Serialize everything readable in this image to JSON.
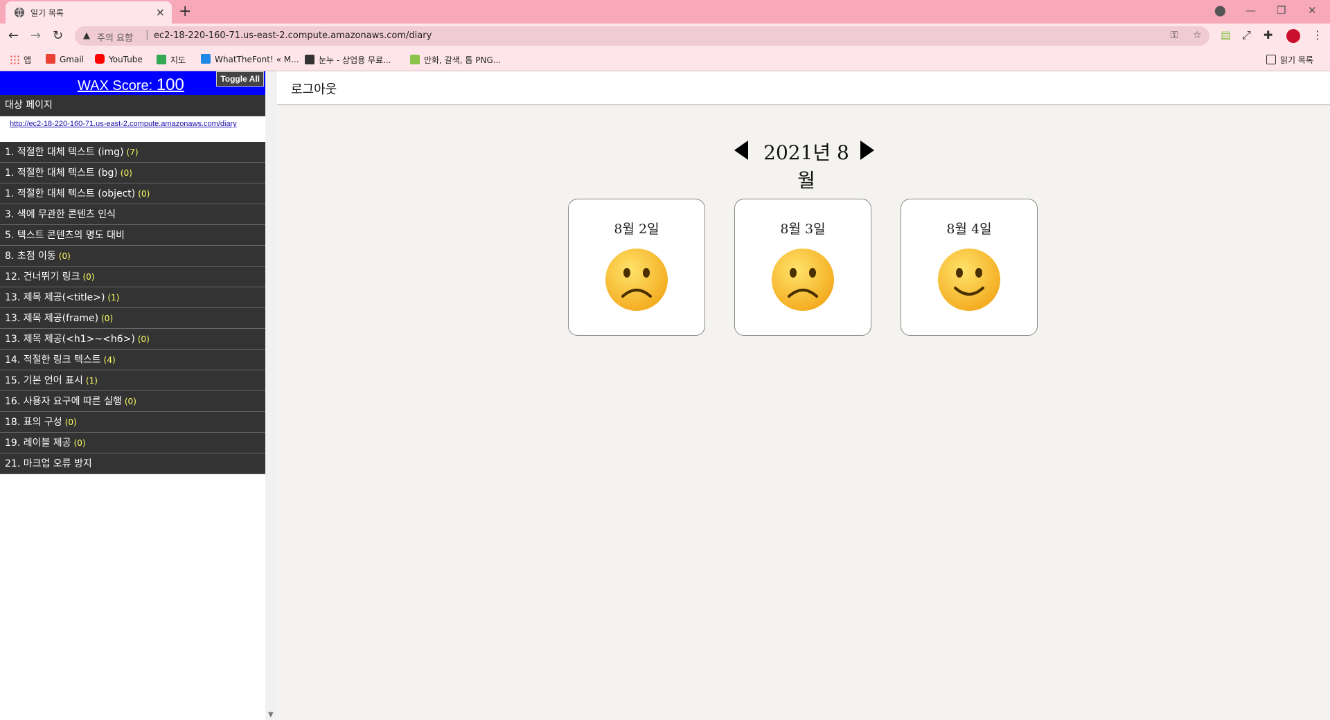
{
  "browser": {
    "tab_title": "일기 목록",
    "tab_close": "×",
    "new_tab": "+",
    "security_warning": "주의 요함",
    "url": "ec2-18-220-160-71.us-east-2.compute.amazonaws.com/diary",
    "reading_list": "읽기 목록"
  },
  "bookmarks": [
    {
      "label": "앱",
      "icon": "apps-grid-icon",
      "color": "#e74c3c"
    },
    {
      "label": "Gmail",
      "icon": "gmail-icon",
      "color": "#ea4335"
    },
    {
      "label": "YouTube",
      "icon": "youtube-icon",
      "color": "#ff0000"
    },
    {
      "label": "지도",
      "icon": "maps-icon",
      "color": "#34a853"
    },
    {
      "label": "WhatTheFont! « M...",
      "icon": "whatthefont-icon",
      "color": "#1e88e5"
    },
    {
      "label": "눈누 - 상업용 무료...",
      "icon": "noonnu-icon",
      "color": "#333333"
    },
    {
      "label": "만화, 갈색, 톱 PNG...",
      "icon": "png-site-icon",
      "color": "#8bc34a"
    }
  ],
  "wax": {
    "label": "WAX Score:",
    "score": "100",
    "toggle_all": "Toggle All",
    "target_heading": "대상 페이지",
    "target_url": "http://ec2-18-220-160-71.us-east-2.compute.amazonaws.com/diary",
    "items": [
      {
        "label": "1. 적절한 대체 텍스트 (img)",
        "count": "(7)"
      },
      {
        "label": "1. 적절한 대체 텍스트 (bg)",
        "count": "(0)"
      },
      {
        "label": "1. 적절한 대체 텍스트 (object)",
        "count": "(0)"
      },
      {
        "label": "3. 색에 무관한 콘텐츠 인식",
        "count": ""
      },
      {
        "label": "5. 텍스트 콘텐츠의 명도 대비",
        "count": ""
      },
      {
        "label": "8. 초점 이동",
        "count": "(0)"
      },
      {
        "label": "12. 건너뛰기 링크",
        "count": "(0)"
      },
      {
        "label": "13. 제목 제공(<title>)",
        "count": "(1)"
      },
      {
        "label": "13. 제목 제공(frame)",
        "count": "(0)"
      },
      {
        "label": "13. 제목 제공(<h1>~<h6>)",
        "count": "(0)"
      },
      {
        "label": "14. 적절한 링크 텍스트",
        "count": "(4)"
      },
      {
        "label": "15. 기본 언어 표시",
        "count": "(1)"
      },
      {
        "label": "16. 사용자 요구에 따른 실행",
        "count": "(0)"
      },
      {
        "label": "18. 표의 구성",
        "count": "(0)"
      },
      {
        "label": "19. 레이블 제공",
        "count": "(0)"
      },
      {
        "label": "21. 마크업 오류 방지",
        "count": ""
      }
    ]
  },
  "main": {
    "logout": "로그아웃",
    "month": "2021년 8월",
    "entries": [
      {
        "date": "8월 2일",
        "mood": "sad"
      },
      {
        "date": "8월 3일",
        "mood": "sad"
      },
      {
        "date": "8월 4일",
        "mood": "happy"
      }
    ]
  }
}
